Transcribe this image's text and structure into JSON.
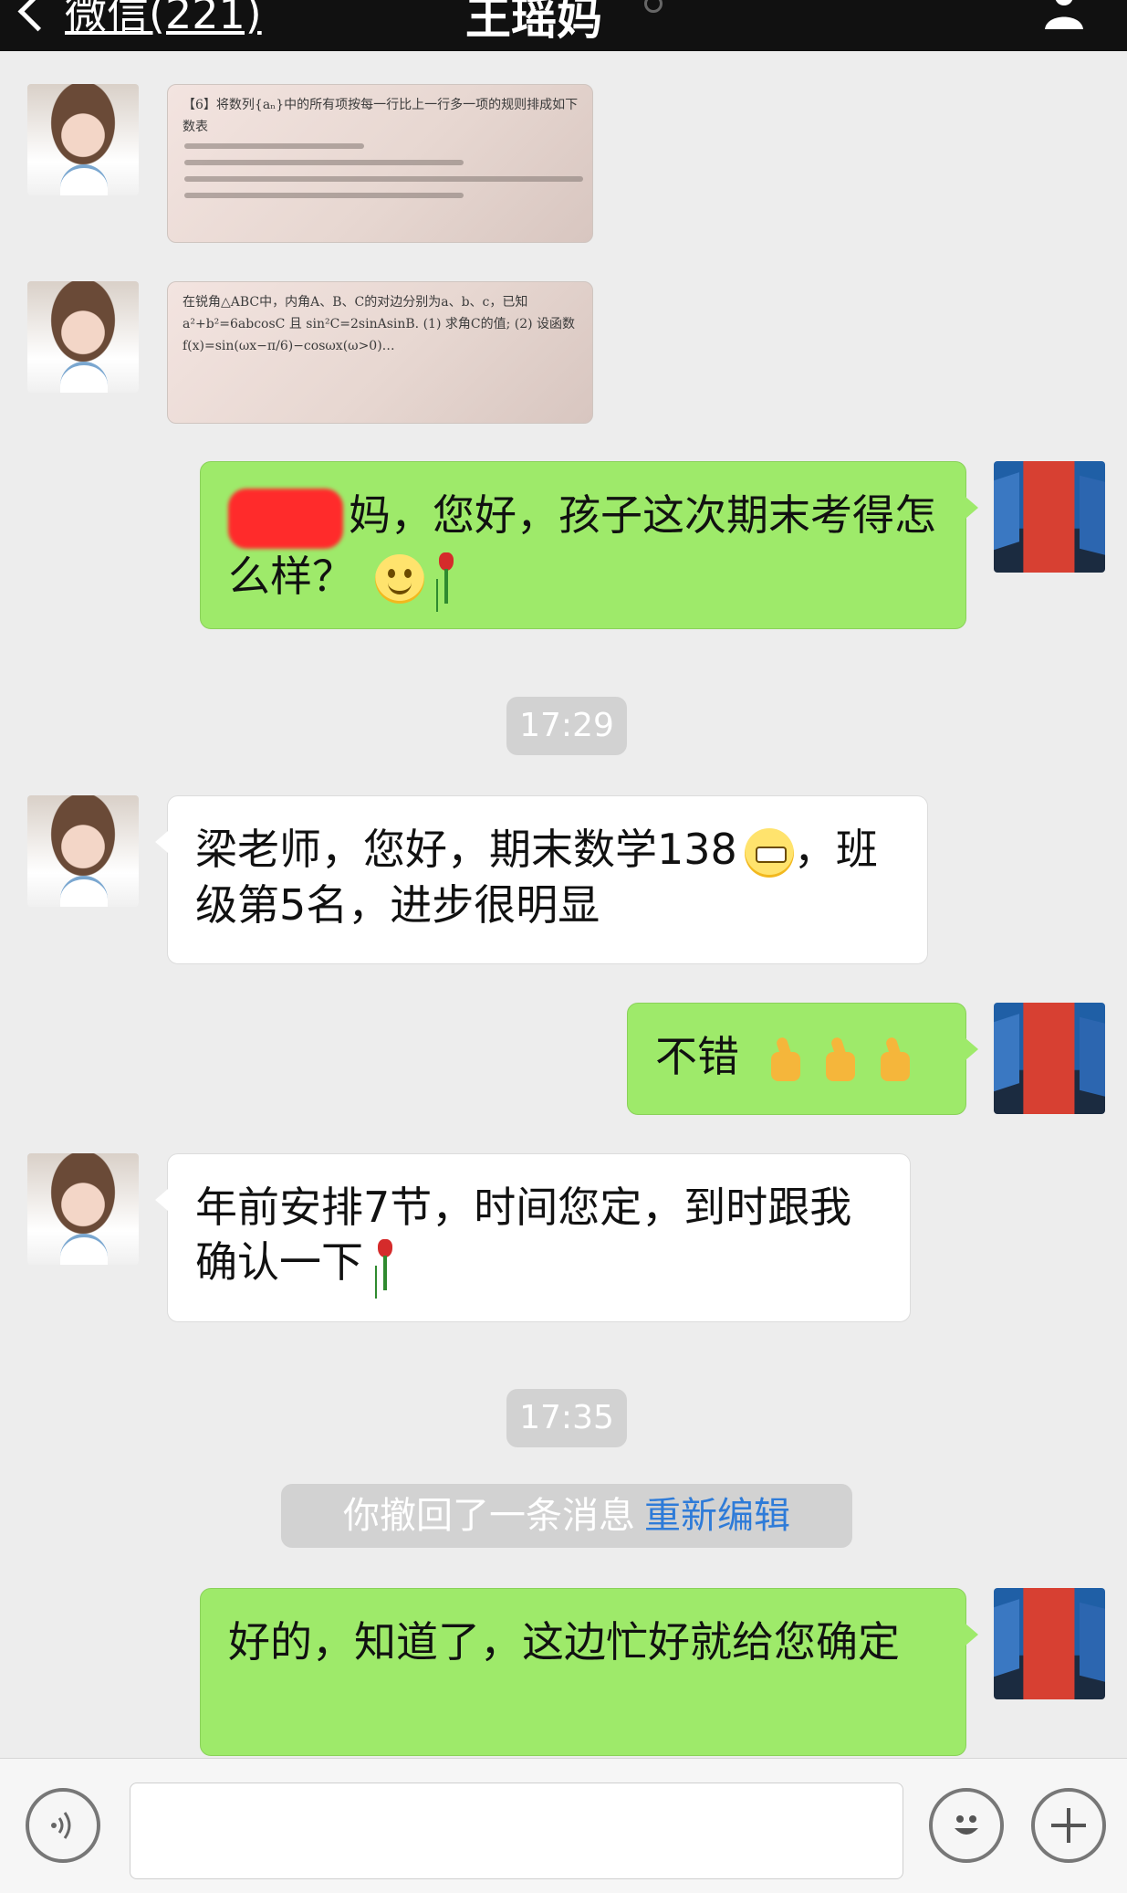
{
  "header": {
    "back_label": "微信(221)",
    "title": "王瑶妈"
  },
  "messages": {
    "img1_caption": "【6】将数列{aₙ}中的所有项按每一行比上一行多一项的规则排成如下数表",
    "img2_caption": "在锐角△ABC中，内角A、B、C的对边分别为a、b、c，已知 a²+b²=6abcosC 且 sin²C=2sinAsinB. (1) 求角C的值; (2) 设函数 f(x)=sin(ωx−π/6)−cosωx(ω>0)…",
    "m1_text": "妈，您好，孩子这次期末考得怎么样？",
    "time1": "17:29",
    "m2_text": "梁老师，您好，期末数学138",
    "m2_tail": "，班级第5名，进步很明显",
    "m3_text": "不错",
    "m4_text": "年前安排7节，时间您定，到时跟我确认一下",
    "time2": "17:35",
    "recall_text": "你撤回了一条消息",
    "recall_edit": "重新编辑",
    "m5_text": "好的，知道了，这边忙好就给您确定"
  },
  "icons": {
    "voice": "voice-icon",
    "emoji": "emoji-icon",
    "plus": "plus-icon"
  },
  "colors": {
    "top_bar": "#111111",
    "background": "#ededed",
    "green_bubble": "#9eea6a",
    "white_bubble": "#ffffff",
    "link_blue": "#2e7bd8"
  }
}
